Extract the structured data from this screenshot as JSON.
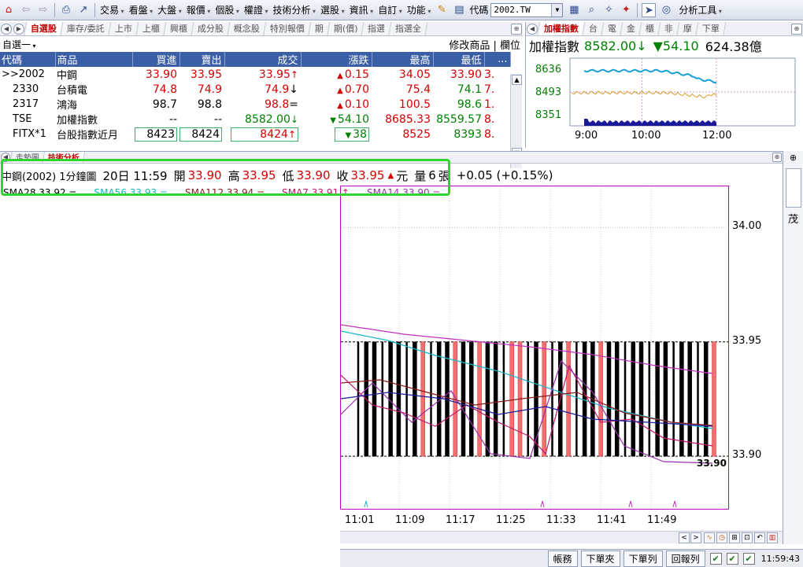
{
  "toolbar": {
    "menus": [
      "交易",
      "看盤",
      "大盤",
      "報價",
      "個股",
      "權證",
      "技術分析",
      "選股",
      "資訊",
      "自訂",
      "功能"
    ],
    "code_label": "代碼",
    "code_value": "2002.TW",
    "analysis_tools": "分析工具"
  },
  "watchlist": {
    "tabs": [
      "自選股",
      "庫存/委託",
      "上市",
      "上櫃",
      "興櫃",
      "成分股",
      "概念股",
      "特別報價",
      "期",
      "期(價)",
      "指選",
      "指選全"
    ],
    "group": "自選一",
    "edit_products": "修改商品",
    "column_btn": "欄位",
    "headers": [
      "代碼",
      "商品",
      "買進",
      "賣出",
      "成交",
      "漲跌",
      "最高",
      "最低",
      "..."
    ],
    "rows": [
      {
        "code": ">>2002",
        "name": "中鋼",
        "bid": "33.90",
        "ask": "33.95",
        "last": "33.95",
        "last_arrow": "↑",
        "change": "0.15",
        "change_dir": "up",
        "high": "34.05",
        "low": "33.90",
        "more": "3."
      },
      {
        "code": "2330",
        "name": "台積電",
        "bid": "74.8",
        "ask": "74.9",
        "last": "74.9",
        "last_arrow": "↓",
        "change": "0.70",
        "change_dir": "up",
        "high": "75.4",
        "low": "74.1",
        "more": "7."
      },
      {
        "code": "2317",
        "name": "鴻海",
        "bid": "98.7",
        "ask": "98.8",
        "last": "98.8",
        "last_arrow": "=",
        "change": "0.10",
        "change_dir": "up",
        "high": "100.5",
        "low": "98.6",
        "more": "1."
      },
      {
        "code": "TSE",
        "name": "加權指數",
        "bid": "--",
        "ask": "--",
        "last": "8582.00",
        "last_arrow": "↓",
        "change": "54.10",
        "change_dir": "down",
        "high": "8685.33",
        "low": "8559.57",
        "more": "8."
      },
      {
        "code": "FITX*1",
        "name": "台股指數近月",
        "bid": "8423",
        "ask": "8424",
        "last": "8424",
        "last_arrow": "↑",
        "change": "38",
        "change_dir": "down",
        "high": "8525",
        "low": "8393",
        "more": "8."
      }
    ]
  },
  "index_panel": {
    "tabs": [
      "加權指數",
      "台",
      "電",
      "金",
      "櫃",
      "非",
      "摩",
      "下單"
    ],
    "name": "加權指數",
    "value": "8582.00",
    "value_arrow": "↓",
    "change": "▼54.10",
    "volume": "624.38億",
    "chart_data": {
      "type": "line",
      "x_labels": [
        "9:00",
        "10:00",
        "12:00"
      ],
      "y_labels": [
        "8636",
        "8493",
        "8351"
      ],
      "colors": {
        "index": "#1aa0d8",
        "futures": "#d89a2a",
        "volume": "#1a1a99"
      }
    }
  },
  "tech": {
    "tabs": [
      "走勢圖",
      "技術分析"
    ],
    "info": {
      "title": "中鋼(2002)",
      "period": "1分鐘圖",
      "date_time": "20日 11:59",
      "open_label": "開",
      "open": "33.90",
      "high_label": "高",
      "high": "33.95",
      "low_label": "低",
      "low": "33.90",
      "close_label": "收",
      "close": "33.95",
      "unit": "元",
      "volume_label": "量",
      "volume": "6",
      "volume_unit": "張",
      "change": "+0.05 (+0.15%)"
    },
    "sma": [
      {
        "label": "SMA28 33.92 =",
        "color": "#000000"
      },
      {
        "label": "SMA56 33.93 =",
        "color": "#1ab5c8"
      },
      {
        "label": "SMA112 33.94 =",
        "color": "#8b1a1a"
      },
      {
        "label": "SMA7 33.91 ↑",
        "color": "#c0186a"
      },
      {
        "label": "SMA14 33.90 =",
        "color": "#9b2fb0"
      }
    ],
    "chart_data": {
      "type": "bar",
      "title": "中鋼(2002) 1分鐘圖",
      "x_labels": [
        "11:01",
        "11:09",
        "11:17",
        "11:25",
        "11:33",
        "11:41",
        "11:49"
      ],
      "y_labels": [
        "34.00",
        "33.95",
        "33.90"
      ],
      "ylim": [
        33.877,
        34.018
      ],
      "last_price_label": "33.90",
      "bars": [
        {
          "dir": "down",
          "lo": 33.9,
          "hi": 33.95
        },
        {
          "dir": "down",
          "lo": 33.9,
          "hi": 33.95
        },
        {
          "dir": "down",
          "lo": 33.9,
          "hi": 33.95
        },
        {
          "dir": "down",
          "lo": 33.9,
          "hi": 33.95
        },
        {
          "dir": "down",
          "lo": 33.9,
          "hi": 33.95
        },
        {
          "dir": "down",
          "lo": 33.9,
          "hi": 33.95
        },
        {
          "dir": "down",
          "lo": 33.9,
          "hi": 33.95
        },
        {
          "dir": "down",
          "lo": 33.9,
          "hi": 33.95
        },
        {
          "dir": "up",
          "lo": 33.9,
          "hi": 33.95
        },
        {
          "dir": "down",
          "lo": 33.9,
          "hi": 33.95
        },
        {
          "dir": "down",
          "lo": 33.9,
          "hi": 33.95
        },
        {
          "dir": "down",
          "lo": 33.9,
          "hi": 33.95
        },
        {
          "dir": "up",
          "lo": 33.9,
          "hi": 33.95
        },
        {
          "dir": "down",
          "lo": 33.9,
          "hi": 33.95
        },
        {
          "dir": "down",
          "lo": 33.9,
          "hi": 33.95
        },
        {
          "dir": "up",
          "lo": 33.9,
          "hi": 33.95
        },
        {
          "dir": "down",
          "lo": 33.9,
          "hi": 33.95
        },
        {
          "dir": "down",
          "lo": 33.9,
          "hi": 33.95
        },
        {
          "dir": "down",
          "lo": 33.9,
          "hi": 33.95
        },
        {
          "dir": "up",
          "lo": 33.9,
          "hi": 33.95
        },
        {
          "dir": "up",
          "lo": 33.9,
          "hi": 33.95
        },
        {
          "dir": "down",
          "lo": 33.9,
          "hi": 33.95
        },
        {
          "dir": "down",
          "lo": 33.9,
          "hi": 33.95
        },
        {
          "dir": "up",
          "lo": 33.9,
          "hi": 33.95
        },
        {
          "dir": "down",
          "lo": 33.9,
          "hi": 33.95
        },
        {
          "dir": "down",
          "lo": 33.9,
          "hi": 33.95
        },
        {
          "dir": "up",
          "lo": 33.9,
          "hi": 33.95
        },
        {
          "dir": "down",
          "lo": 33.9,
          "hi": 33.95
        },
        {
          "dir": "down",
          "lo": 33.9,
          "hi": 33.95
        },
        {
          "dir": "down",
          "lo": 33.9,
          "hi": 33.95
        },
        {
          "dir": "up",
          "lo": 33.9,
          "hi": 33.95
        },
        {
          "dir": "down",
          "lo": 33.9,
          "hi": 33.95
        },
        {
          "dir": "down",
          "lo": 33.9,
          "hi": 33.95
        },
        {
          "dir": "down",
          "lo": 33.9,
          "hi": 33.95
        },
        {
          "dir": "down",
          "lo": 33.9,
          "hi": 33.95
        },
        {
          "dir": "down",
          "lo": 33.9,
          "hi": 33.95
        },
        {
          "dir": "down",
          "lo": 33.9,
          "hi": 33.95
        },
        {
          "dir": "down",
          "lo": 33.9,
          "hi": 33.95
        },
        {
          "dir": "down",
          "lo": 33.9,
          "hi": 33.95
        },
        {
          "dir": "down",
          "lo": 33.9,
          "hi": 33.95
        },
        {
          "dir": "down",
          "lo": 33.9,
          "hi": 33.95
        },
        {
          "dir": "down",
          "lo": 33.9,
          "hi": 33.95
        },
        {
          "dir": "down",
          "lo": 33.9,
          "hi": 33.95
        },
        {
          "dir": "down",
          "lo": 33.9,
          "hi": 33.95
        },
        {
          "dir": "up",
          "lo": 33.9,
          "hi": 33.95
        }
      ],
      "colors": {
        "up": "#f07070",
        "down": "#000000",
        "frame": "#c000c0"
      }
    }
  },
  "status": {
    "buttons": [
      "帳務",
      "下單夾",
      "下單列",
      "回報列"
    ],
    "clock": "11:59:43"
  },
  "side": {
    "label": "茂"
  }
}
